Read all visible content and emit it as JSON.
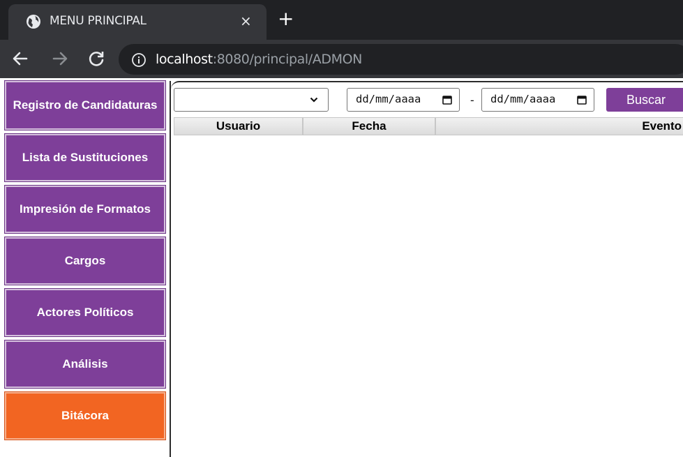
{
  "browser": {
    "tab": {
      "title": "MENU PRINCIPAL",
      "close": "×"
    },
    "new_tab": "+",
    "url_host": "localhost",
    "url_path": ":8080/principal/ADMON"
  },
  "sidebar": {
    "items": [
      {
        "label": "Registro de Candidaturas"
      },
      {
        "label": "Lista de Sustituciones"
      },
      {
        "label": "Impresión de Formatos"
      },
      {
        "label": "Cargos"
      },
      {
        "label": "Actores Políticos"
      },
      {
        "label": "Análisis"
      },
      {
        "label": "Bitácora",
        "active": true
      }
    ]
  },
  "filters": {
    "select_value": "",
    "date_from": "dd/mm/aaaa",
    "separator": "-",
    "date_to": "dd/mm/aaaa",
    "search_button": "Buscar"
  },
  "table": {
    "columns": [
      "Usuario",
      "Fecha",
      "Evento"
    ],
    "rows": []
  },
  "colors": {
    "menu_purple": "#7e3f99",
    "menu_active_orange": "#f26522"
  }
}
